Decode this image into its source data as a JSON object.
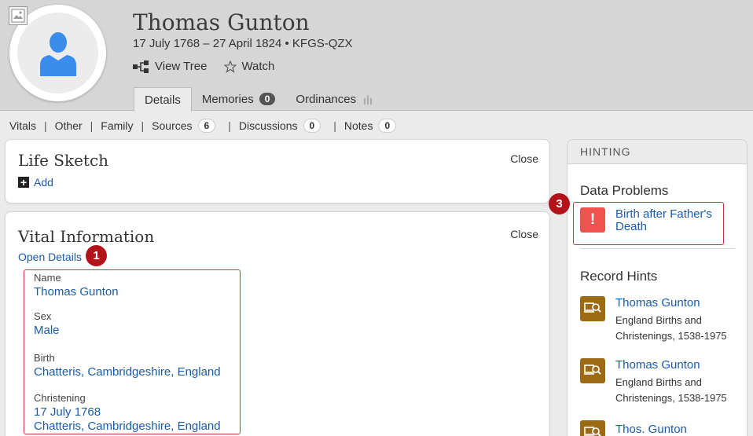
{
  "person": {
    "name": "Thomas Gunton",
    "meta": "17 July 1768 – 27 April 1824 • KFGS-QZX"
  },
  "actions": {
    "view_tree": "View Tree",
    "watch": "Watch"
  },
  "tabs": [
    {
      "label": "Details",
      "active": true
    },
    {
      "label": "Memories",
      "count": "0"
    },
    {
      "label": "Ordinances"
    }
  ],
  "subnav": [
    {
      "label": "Vitals"
    },
    {
      "label": "Other"
    },
    {
      "label": "Family"
    },
    {
      "label": "Sources",
      "count": "6"
    },
    {
      "label": "Discussions",
      "count": "0"
    },
    {
      "label": "Notes",
      "count": "0"
    }
  ],
  "life_sketch": {
    "title": "Life Sketch",
    "close": "Close",
    "add": "Add"
  },
  "vital_info": {
    "title": "Vital Information",
    "close": "Close",
    "open_details": "Open Details",
    "badge": "1",
    "fields": [
      {
        "label": "Name",
        "value": "Thomas Gunton"
      },
      {
        "label": "Sex",
        "value": "Male"
      },
      {
        "label": "Birth",
        "value": "Chatteris, Cambridgeshire, England"
      },
      {
        "label": "Christening",
        "value": "17 July 1768",
        "value2": "Chatteris, Cambridgeshire, England"
      }
    ]
  },
  "hinting": {
    "header": "HINTING",
    "data_problems_title": "Data Problems",
    "badge": "3",
    "problem": {
      "line1": "Birth after Father's",
      "line2": "Death"
    },
    "record_hints_title": "Record Hints",
    "records": [
      {
        "name": "Thomas Gunton",
        "desc": "England Births and Christenings, 1538-1975"
      },
      {
        "name": "Thomas Gunton",
        "desc": "England Births and Christenings, 1538-1975"
      },
      {
        "name": "Thos. Gunton",
        "desc": ""
      }
    ]
  },
  "colors": {
    "link": "#1a5ba8",
    "highlight": "#c8323c",
    "badge": "#b3121a",
    "problem_icon": "#ef5350",
    "record_icon": "#9d6a14",
    "avatar": "#3b8ded"
  }
}
